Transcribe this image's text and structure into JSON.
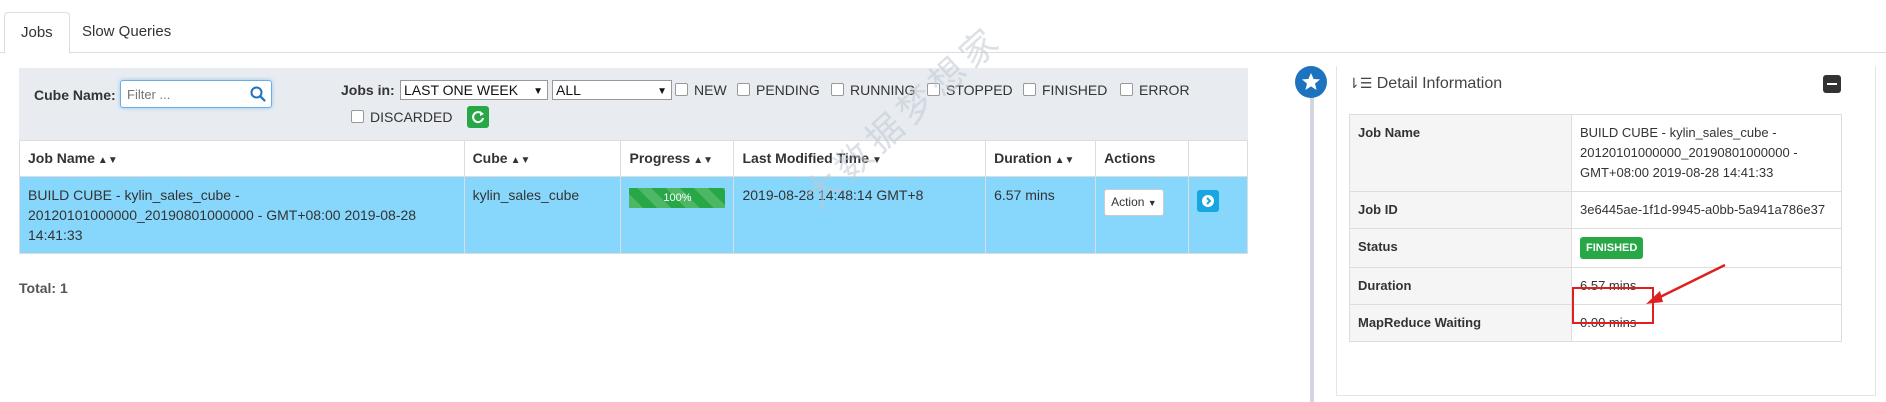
{
  "tabs": [
    {
      "label": "Jobs",
      "active": true
    },
    {
      "label": "Slow Queries",
      "active": false
    }
  ],
  "filters": {
    "cube_name_label": "Cube Name:",
    "search_placeholder": "Filter ...",
    "jobs_in_label": "Jobs in:",
    "time_range": "LAST ONE WEEK",
    "project": "ALL",
    "statuses": [
      "NEW",
      "PENDING",
      "RUNNING",
      "STOPPED",
      "FINISHED",
      "ERROR",
      "DISCARDED"
    ]
  },
  "table": {
    "columns": [
      "Job Name",
      "Cube",
      "Progress",
      "Last Modified Time",
      "Duration",
      "Actions"
    ],
    "rows": [
      {
        "job_name": "BUILD CUBE - kylin_sales_cube - 20120101000000_20190801000000 - GMT+08:00 2019-08-28 14:41:33",
        "cube": "kylin_sales_cube",
        "progress": "100%",
        "last_modified": "2019-08-28 14:48:14 GMT+8",
        "duration": "6.57 mins",
        "action_label": "Action"
      }
    ]
  },
  "total_label": "Total: 1",
  "watermark": "大数据梦想家",
  "detail": {
    "title": "Detail Information",
    "rows": [
      {
        "key": "Job Name",
        "value": "BUILD CUBE - kylin_sales_cube - 20120101000000_20190801000000 - GMT+08:00 2019-08-28 14:41:33"
      },
      {
        "key": "Job ID",
        "value": "3e6445ae-1f1d-9945-a0bb-5a941a786e37"
      },
      {
        "key": "Status",
        "value": "FINISHED"
      },
      {
        "key": "Duration",
        "value": "6.57 mins"
      },
      {
        "key": "MapReduce Waiting",
        "value": "0.00 mins"
      }
    ]
  },
  "colors": {
    "selected_row": "#87d7fc",
    "success": "#27a745",
    "primary": "#1e73be",
    "annotation_red": "#e02020"
  }
}
